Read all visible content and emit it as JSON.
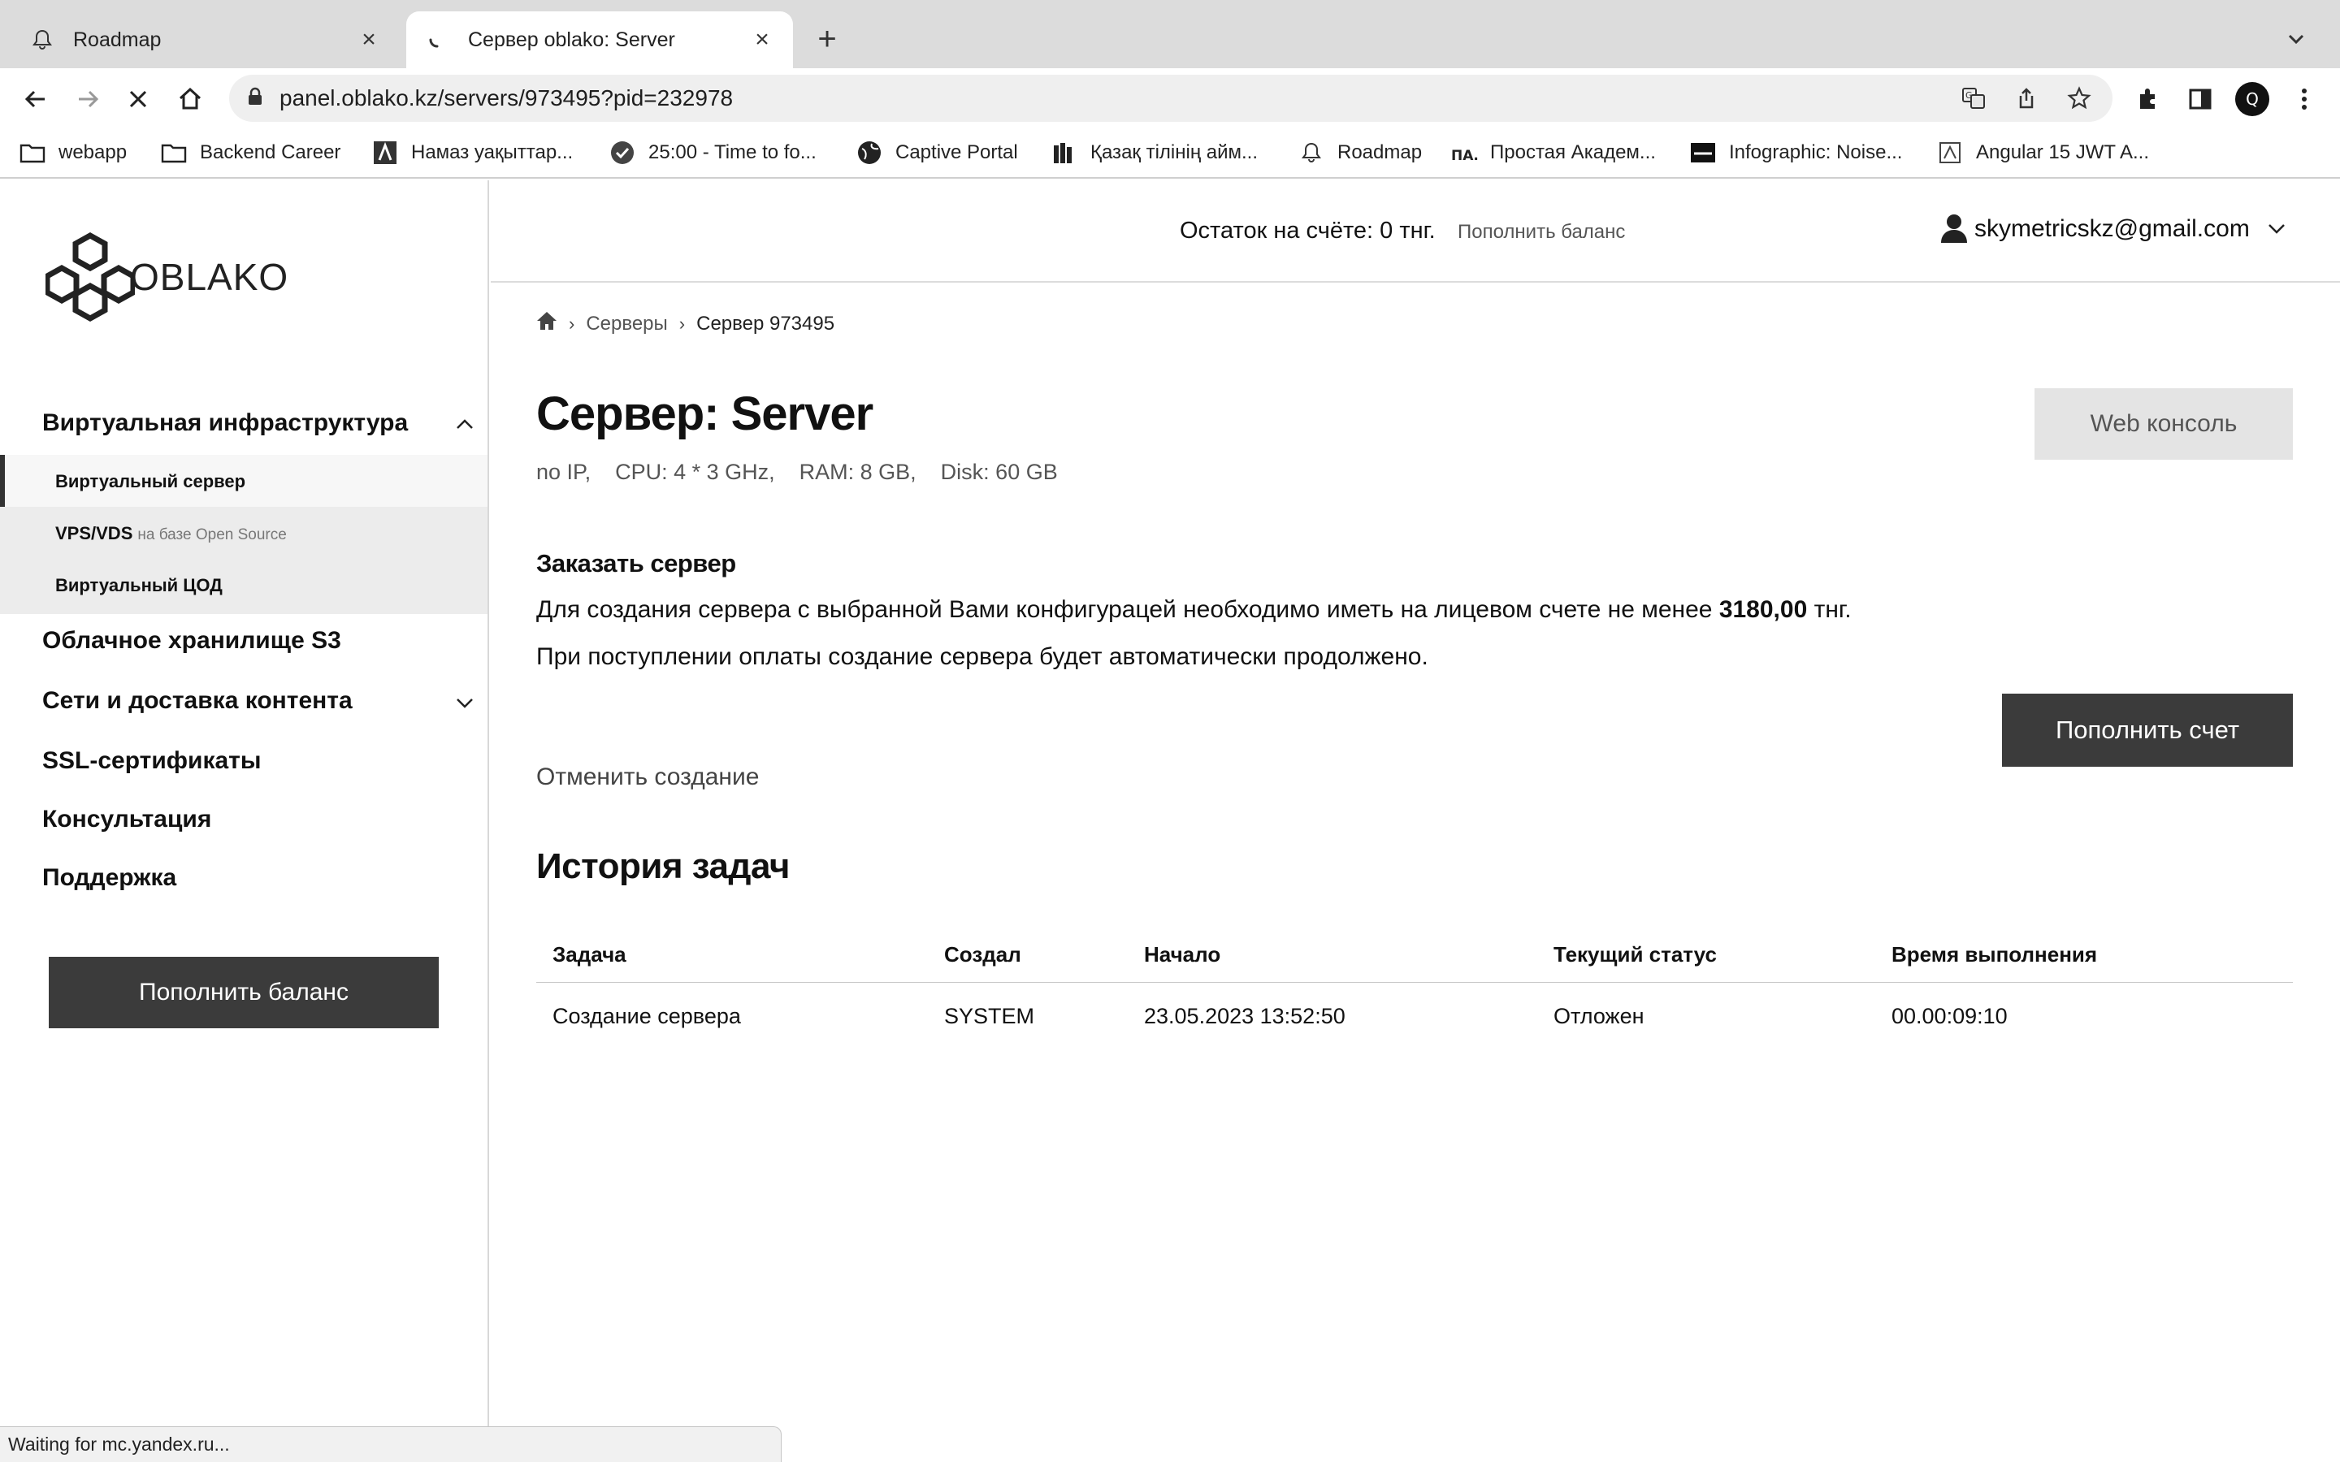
{
  "browser": {
    "tabs": [
      {
        "title": "Roadmap",
        "active": false
      },
      {
        "title": "Сервер oblako: Server",
        "active": true
      }
    ],
    "url": "panel.oblako.kz/servers/973495?pid=232978",
    "profile_initial": "Q",
    "bookmarks": [
      {
        "label": "webapp",
        "icon": "folder-icon"
      },
      {
        "label": "Backend Career",
        "icon": "folder-icon"
      },
      {
        "label": "Намаз уақыттар...",
        "icon": "site-icon"
      },
      {
        "label": "25:00 - Time to fo...",
        "icon": "check-circle-icon"
      },
      {
        "label": "Captive Portal",
        "icon": "globe-icon"
      },
      {
        "label": "Қазақ тілінің айм...",
        "icon": "books-icon"
      },
      {
        "label": "Roadmap",
        "icon": "bell-icon"
      },
      {
        "label": "Простая Академ...",
        "icon": "pa-icon"
      },
      {
        "label": "Infographic: Noise...",
        "icon": "site-icon"
      },
      {
        "label": "Angular 15 JWT A...",
        "icon": "site-icon"
      }
    ],
    "status_text": "Waiting for mc.yandex.ru..."
  },
  "sidebar": {
    "logo_text": "OBLAKO",
    "sections": [
      {
        "label": "Виртуальная инфраструктура",
        "expanded": true
      },
      {
        "label": "Облачное хранилище S3"
      },
      {
        "label": "Сети и доставка контента",
        "expanded": false
      },
      {
        "label": "SSL-сертификаты"
      },
      {
        "label": "Консультация"
      },
      {
        "label": "Поддержка"
      }
    ],
    "subitems": [
      {
        "label": "Виртуальный сервер",
        "note": ""
      },
      {
        "label": "VPS/VDS",
        "note": "на базе Open Source"
      },
      {
        "label": "Виртуальный ЦОД",
        "note": ""
      }
    ],
    "cta_label": "Пополнить баланс"
  },
  "header": {
    "balance_text": "Остаток на счёте: 0 тнг.",
    "topup_link": "Пополнить баланс",
    "user_email": "skymetricskz@gmail.com"
  },
  "breadcrumbs": [
    "Серверы",
    "Сервер 973495"
  ],
  "server": {
    "title": "Сервер: Server",
    "specs": [
      "no IP,",
      "CPU: 4 * 3 GHz,",
      "RAM: 8 GB,",
      "Disk: 60 GB"
    ],
    "web_console_label": "Web консоль"
  },
  "order": {
    "heading": "Заказать сервер",
    "line1_prefix": "Для создания сервера с выбранной Вами конфигурацей необходимо иметь на лицевом счете не менее",
    "line1_amount": "3180,00",
    "line1_suffix": "тнг.",
    "line2": "При поступлении оплаты создание сервера будет автоматически продолжено.",
    "topup_button": "Пополнить счет",
    "cancel_link": "Отменить создание"
  },
  "history": {
    "heading": "История задач",
    "columns": [
      "Задача",
      "Создал",
      "Начало",
      "Текущий статус",
      "Время выполнения"
    ],
    "rows": [
      [
        "Создание сервера",
        "SYSTEM",
        "23.05.2023 13:52:50",
        "Отложен",
        "00.00:09:10"
      ]
    ]
  }
}
